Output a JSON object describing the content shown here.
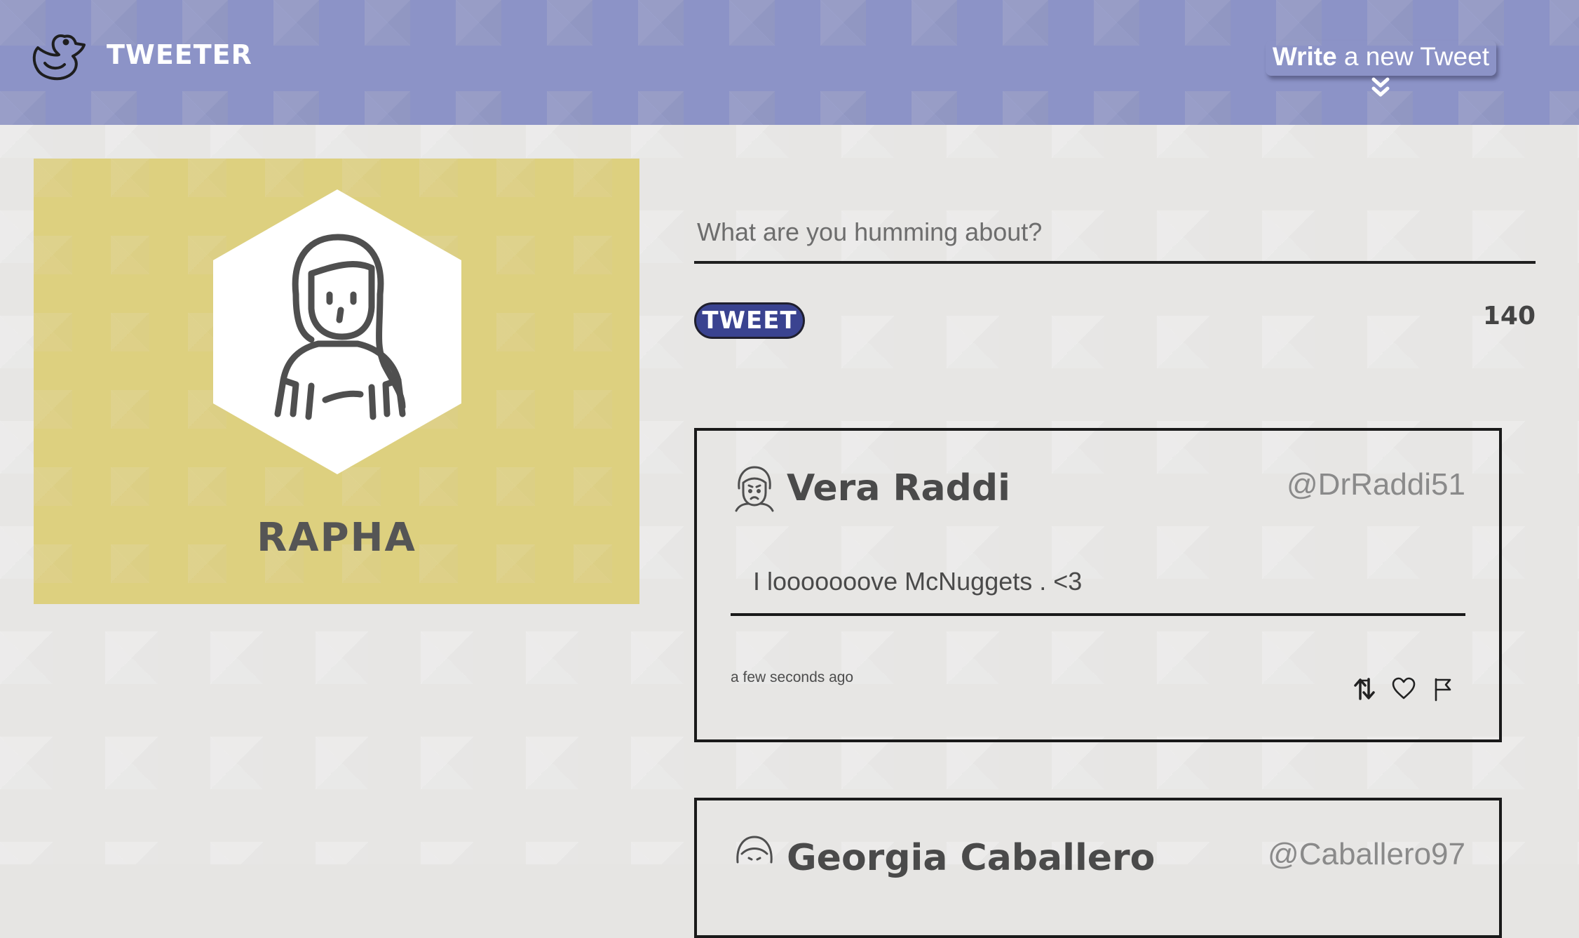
{
  "nav": {
    "brand": "TWEETER",
    "compose_toggle_bold": "Write",
    "compose_toggle_rest": " a new Tweet",
    "logo_icon": "duck-icon",
    "toggle_icon": "double-chevron-down-icon",
    "color": "#8c93c7"
  },
  "profile": {
    "name": "RAPHA",
    "avatar_icon": "girl-avatar-icon",
    "color": "#ddd07f"
  },
  "compose": {
    "placeholder": "What are you humming about?",
    "button_label": "TWEET",
    "char_count": "140",
    "button_color": "#3a4390"
  },
  "tweets": [
    {
      "name": "Vera Raddi",
      "handle": "@DrRaddi51",
      "text": "I looooooove McNuggets . <3",
      "time": "a few seconds ago",
      "avatar_icon": "sad-face-avatar-icon",
      "actions": [
        "retweet-icon",
        "heart-icon",
        "flag-icon"
      ]
    },
    {
      "name": "Georgia Caballero",
      "handle": "@Caballero97",
      "avatar_icon": "face-avatar-icon"
    }
  ]
}
